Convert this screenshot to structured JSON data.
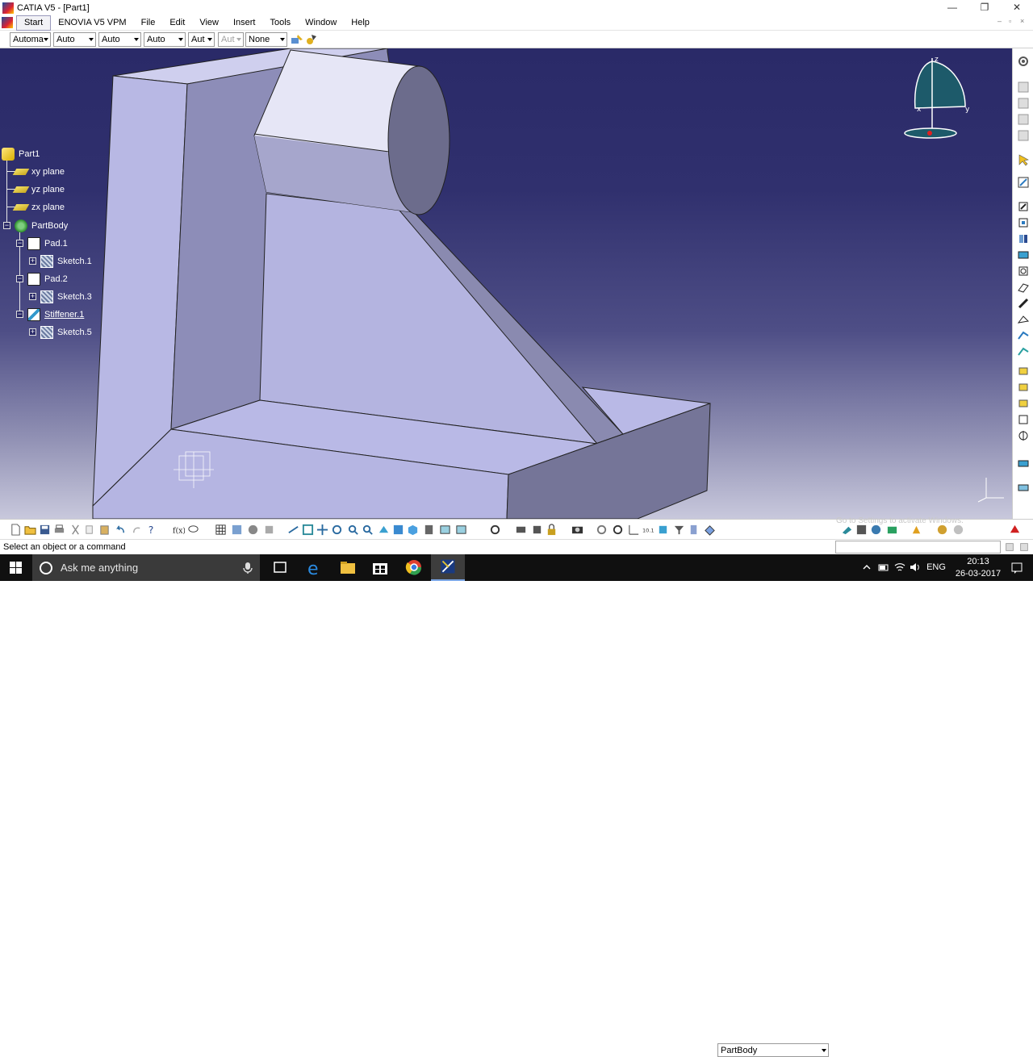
{
  "window": {
    "title": "CATIA V5 - [Part1]",
    "controls": [
      "—",
      "❐",
      "✕"
    ]
  },
  "menubar": {
    "items": [
      "Start",
      "ENOVIA V5 VPM",
      "File",
      "Edit",
      "View",
      "Insert",
      "Tools",
      "Window",
      "Help"
    ],
    "mdi_controls": [
      "–",
      "▫",
      "×"
    ]
  },
  "combobar": {
    "combos": [
      {
        "value": "Automa",
        "disabled": false
      },
      {
        "value": "Auto",
        "disabled": false
      },
      {
        "value": "Auto",
        "disabled": false
      },
      {
        "value": "Auto",
        "disabled": false
      },
      {
        "value": "Aut",
        "disabled": false
      },
      {
        "value": "Aut",
        "disabled": true
      },
      {
        "value": "None",
        "disabled": false
      }
    ]
  },
  "tree": {
    "nodes": [
      {
        "label": "Part1",
        "icon": "part-icon"
      },
      {
        "label": "xy plane",
        "icon": "plane-icon"
      },
      {
        "label": "yz plane",
        "icon": "plane-icon"
      },
      {
        "label": "zx plane",
        "icon": "plane-icon"
      },
      {
        "label": "PartBody",
        "icon": "body-icon"
      },
      {
        "label": "Pad.1",
        "icon": "pad-icon"
      },
      {
        "label": "Sketch.1",
        "icon": "sketch-icon"
      },
      {
        "label": "Pad.2",
        "icon": "pad-icon"
      },
      {
        "label": "Sketch.3",
        "icon": "sketch-icon"
      },
      {
        "label": "Stiffener.1",
        "icon": "stiffener-icon"
      },
      {
        "label": "Sketch.5",
        "icon": "sketch-icon"
      }
    ]
  },
  "compass": {
    "axes": [
      "z",
      "x",
      "y"
    ]
  },
  "bottom_toolbar": {
    "current_body": "PartBody",
    "watermark": "Go to Settings to activate Windows."
  },
  "status": {
    "message": "Select an object or a command"
  },
  "taskbar": {
    "search_placeholder": "Ask me anything",
    "language": "ENG",
    "time": "20:13",
    "date": "26-03-2017"
  },
  "colors": {
    "viewport_top": "#2a2a68",
    "part_face": "#b9b9e6",
    "tree_text": "#ffffff"
  }
}
